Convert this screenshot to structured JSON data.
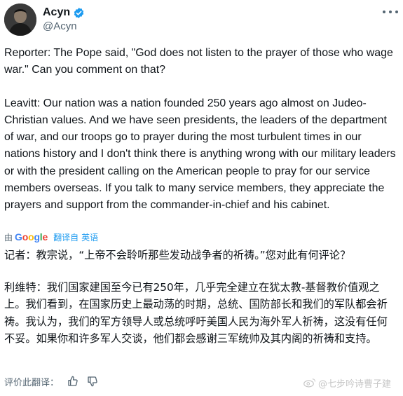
{
  "author": {
    "display_name": "Acyn",
    "handle": "@Acyn",
    "verified_icon": "verified-badge-icon",
    "verified_color": "#1d9bf0"
  },
  "tweet": {
    "paragraph_1": "Reporter: The Pope said, \"God does not listen to the prayer of those who wage war.\" Can you comment on that?",
    "paragraph_2": "Leavitt: Our nation was a nation founded 250 years ago almost on Judeo-Christian values. And we have seen presidents, the leaders of the department of war, and our troops go to prayer during the most turbulent times in our nations history and I don't think there is anything wrong with our military leaders or with the president calling on the American people to pray for our service members overseas. If you talk to many service members, they appreciate the prayers and support from the commander-in-chief and his cabinet."
  },
  "translation": {
    "by_label": "由",
    "provider": "Google",
    "translate_label": "翻译自",
    "source_language": "英语",
    "paragraph_1": "记者：教宗说，“上帝不会聆听那些发动战争者的祈祷。”您对此有何评论？",
    "paragraph_2": "利维特：我们国家建国至今已有250年，几乎完全建立在犹太教-基督教价值观之上。我们看到，在国家历史上最动荡的时期，总统、国防部长和我们的军队都会祈祷。我认为，我们的军方领导人或总统呼吁美国人民为海外军人祈祷，这没有任何不妥。如果你和许多军人交谈，他们都会感谢三军统帅及其内阁的祈祷和支持。"
  },
  "rating": {
    "label": "评价此翻译：",
    "thumbs_up_icon": "thumbs-up-icon",
    "thumbs_down_icon": "thumbs-down-icon"
  },
  "watermark": {
    "text": "@七步吟诗曹子建"
  },
  "colors": {
    "text": "#0f1419",
    "secondary": "#536471",
    "link": "#1d9bf0"
  }
}
